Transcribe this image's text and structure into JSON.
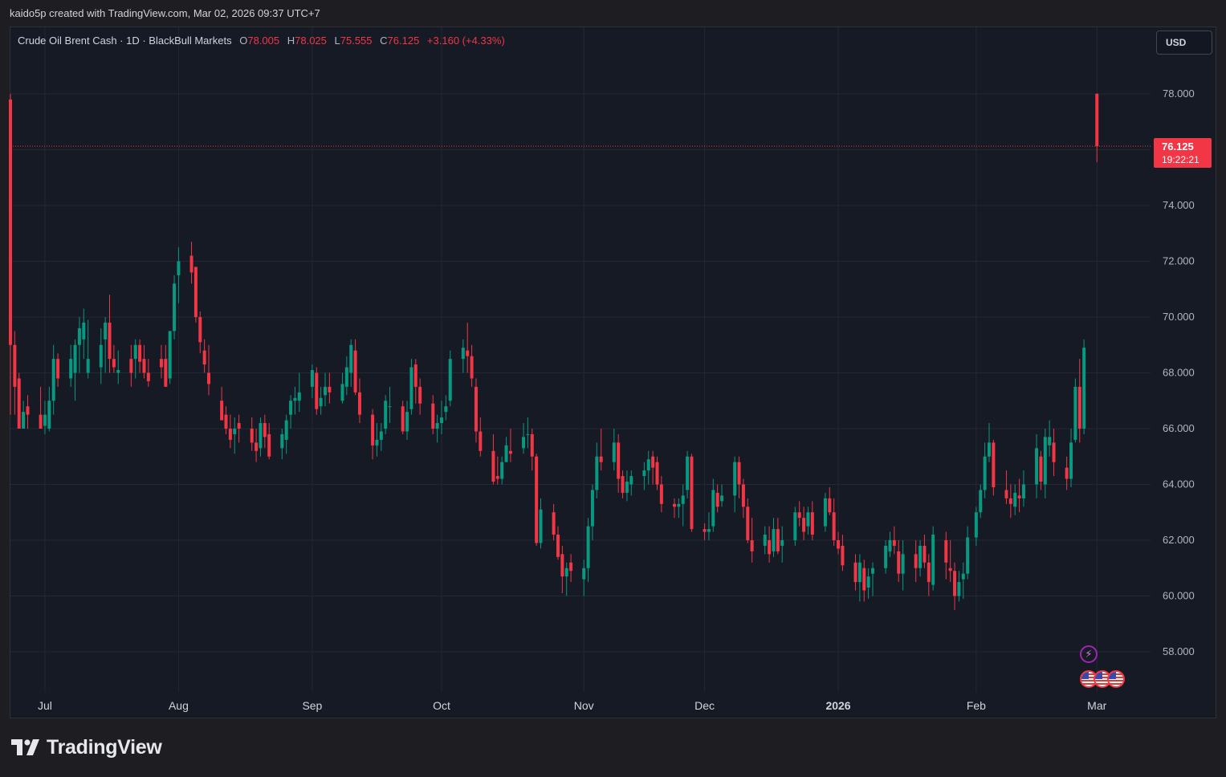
{
  "header": {
    "text": "kaido5p created with TradingView.com, Mar 02, 2026 09:37 UTC+7"
  },
  "legend": {
    "symbol": "Crude Oil Brent Cash · 1D · BlackBull Markets",
    "open_label": "O",
    "open": "78.005",
    "high_label": "H",
    "high": "78.025",
    "low_label": "L",
    "low": "75.555",
    "close_label": "C",
    "close": "76.125",
    "change": "+3.160 (+4.33%)"
  },
  "currency_button": "USD",
  "last_price": {
    "value": "76.125",
    "countdown": "19:22:21"
  },
  "footer": {
    "brand": "TradingView"
  },
  "icons": {
    "event": "lightning-icon",
    "flags": "us-flag-icon"
  },
  "colors": {
    "up": "#089981",
    "down": "#f23645",
    "background": "#161a25",
    "grid": "#242832"
  },
  "chart_data": {
    "type": "candlestick",
    "ylim": [
      57,
      80
    ],
    "y_ticks": [
      "78.000",
      "76.000",
      "74.000",
      "72.000",
      "70.000",
      "68.000",
      "66.000",
      "64.000",
      "62.000",
      "60.000",
      "58.000"
    ],
    "x_ticks": [
      "Jul",
      "Aug",
      "Sep",
      "Oct",
      "Nov",
      "Dec",
      "2026",
      "Feb",
      "Mar"
    ],
    "x_tick_dates": [
      "2025-07-01",
      "2025-08-01",
      "2025-09-01",
      "2025-10-01",
      "2025-11-03",
      "2025-12-01",
      "2026-01-01",
      "2026-02-02",
      "2026-03-02"
    ],
    "last_price": 76.125,
    "bars": [
      [
        "2025-06-23",
        77.8,
        78.0,
        66.5,
        69.0
      ],
      [
        "2025-06-24",
        69.0,
        69.5,
        66.5,
        67.5
      ],
      [
        "2025-06-25",
        67.8,
        68.0,
        66.2,
        66.0
      ],
      [
        "2025-06-26",
        66.0,
        67.0,
        66.0,
        66.6
      ],
      [
        "2025-06-27",
        66.8,
        67.2,
        66.0,
        66.5
      ],
      [
        "2025-06-30",
        66.5,
        67.5,
        66.2,
        66.0
      ],
      [
        "2025-07-01",
        66.1,
        67.0,
        65.8,
        66.5
      ],
      [
        "2025-07-02",
        66.0,
        67.5,
        65.9,
        67.0
      ],
      [
        "2025-07-03",
        67.0,
        69.0,
        66.5,
        68.5
      ],
      [
        "2025-07-04",
        68.5,
        68.7,
        67.5,
        67.8
      ],
      [
        "2025-07-07",
        67.8,
        69.0,
        67.5,
        68.5
      ],
      [
        "2025-07-08",
        68.0,
        69.2,
        67.0,
        69.0
      ],
      [
        "2025-07-09",
        69.0,
        70.0,
        68.0,
        69.6
      ],
      [
        "2025-07-10",
        69.2,
        70.3,
        68.5,
        69.8
      ],
      [
        "2025-07-11",
        68.0,
        69.9,
        67.8,
        68.5
      ],
      [
        "2025-07-14",
        68.2,
        69.6,
        67.6,
        69.0
      ],
      [
        "2025-07-15",
        69.2,
        70.0,
        68.0,
        69.8
      ],
      [
        "2025-07-16",
        69.8,
        70.8,
        68.0,
        68.5
      ],
      [
        "2025-07-17",
        68.5,
        69.0,
        68.0,
        68.2
      ],
      [
        "2025-07-18",
        68.0,
        68.8,
        67.6,
        68.1
      ],
      [
        "2025-07-21",
        68.5,
        69.0,
        67.5,
        68.0
      ],
      [
        "2025-07-22",
        68.5,
        69.2,
        67.8,
        69.0
      ],
      [
        "2025-07-23",
        69.0,
        69.2,
        68.0,
        68.4
      ],
      [
        "2025-07-24",
        68.5,
        69.0,
        67.8,
        68.0
      ],
      [
        "2025-07-25",
        68.0,
        68.5,
        67.5,
        67.7
      ],
      [
        "2025-07-28",
        68.5,
        69.0,
        67.8,
        68.2
      ],
      [
        "2025-07-29",
        68.5,
        69.0,
        67.5,
        67.5
      ],
      [
        "2025-07-30",
        67.8,
        69.5,
        67.6,
        69.5
      ],
      [
        "2025-07-31",
        69.5,
        71.5,
        69.2,
        71.2
      ],
      [
        "2025-08-01",
        71.5,
        72.5,
        70.5,
        72.0
      ],
      [
        "2025-08-04",
        72.2,
        72.7,
        71.2,
        71.6
      ],
      [
        "2025-08-05",
        71.8,
        71.8,
        69.8,
        70.0
      ],
      [
        "2025-08-06",
        70.0,
        70.2,
        68.7,
        69.1
      ],
      [
        "2025-08-07",
        68.8,
        69.2,
        68.0,
        68.3
      ],
      [
        "2025-08-08",
        68.0,
        69.0,
        67.2,
        67.6
      ],
      [
        "2025-08-11",
        67.0,
        67.5,
        66.5,
        66.3
      ],
      [
        "2025-08-12",
        66.5,
        66.8,
        65.8,
        66.0
      ],
      [
        "2025-08-13",
        66.0,
        66.5,
        65.3,
        65.6
      ],
      [
        "2025-08-14",
        65.8,
        66.4,
        65.1,
        66.0
      ],
      [
        "2025-08-15",
        66.2,
        66.5,
        65.5,
        66.0
      ],
      [
        "2025-08-18",
        66.0,
        66.4,
        65.2,
        65.5
      ],
      [
        "2025-08-19",
        65.5,
        66.0,
        64.8,
        65.2
      ],
      [
        "2025-08-20",
        65.3,
        66.4,
        65.0,
        66.2
      ],
      [
        "2025-08-21",
        66.2,
        66.5,
        65.3,
        65.7
      ],
      [
        "2025-08-22",
        65.8,
        66.2,
        64.9,
        65.0
      ],
      [
        "2025-08-25",
        65.3,
        66.0,
        64.9,
        65.8
      ],
      [
        "2025-08-26",
        65.6,
        66.5,
        65.1,
        66.3
      ],
      [
        "2025-08-27",
        66.5,
        67.2,
        66.0,
        67.0
      ],
      [
        "2025-08-28",
        67.0,
        67.5,
        66.5,
        67.1
      ],
      [
        "2025-08-29",
        67.0,
        68.0,
        66.6,
        67.3
      ],
      [
        "2025-09-01",
        67.5,
        68.3,
        67.1,
        68.1
      ],
      [
        "2025-09-02",
        68.0,
        68.2,
        66.5,
        66.7
      ],
      [
        "2025-09-03",
        66.8,
        67.5,
        66.5,
        67.1
      ],
      [
        "2025-09-04",
        67.2,
        68.0,
        66.8,
        67.5
      ],
      [
        "2025-09-05",
        67.5,
        68.0,
        66.9,
        67.3
      ],
      [
        "2025-09-08",
        67.0,
        68.0,
        66.9,
        67.6
      ],
      [
        "2025-09-09",
        67.5,
        68.6,
        67.2,
        68.2
      ],
      [
        "2025-09-10",
        68.0,
        69.2,
        67.5,
        69.0
      ],
      [
        "2025-09-11",
        68.8,
        69.2,
        67.2,
        67.3
      ],
      [
        "2025-09-12",
        67.3,
        67.8,
        66.2,
        66.5
      ],
      [
        "2025-09-15",
        66.5,
        66.7,
        64.9,
        65.4
      ],
      [
        "2025-09-16",
        65.4,
        66.2,
        65.0,
        65.6
      ],
      [
        "2025-09-17",
        65.6,
        66.2,
        65.2,
        65.9
      ],
      [
        "2025-09-18",
        66.0,
        67.2,
        65.8,
        67.0
      ],
      [
        "2025-09-19",
        66.8,
        67.5,
        66.2,
        66.8
      ],
      [
        "2025-09-22",
        66.8,
        67.0,
        65.8,
        65.9
      ],
      [
        "2025-09-23",
        65.9,
        67.0,
        65.6,
        66.6
      ],
      [
        "2025-09-24",
        66.7,
        68.5,
        66.5,
        68.2
      ],
      [
        "2025-09-25",
        68.3,
        68.5,
        66.9,
        67.5
      ],
      [
        "2025-09-26",
        67.5,
        67.8,
        66.5,
        66.9
      ],
      [
        "2025-09-29",
        66.9,
        67.2,
        65.8,
        66.0
      ],
      [
        "2025-09-30",
        66.0,
        66.5,
        65.5,
        66.2
      ],
      [
        "2025-10-01",
        66.2,
        67.0,
        65.8,
        66.4
      ],
      [
        "2025-10-02",
        66.6,
        67.2,
        66.3,
        66.8
      ],
      [
        "2025-10-03",
        67.0,
        68.8,
        66.8,
        68.5
      ],
      [
        "2025-10-06",
        68.5,
        69.2,
        68.0,
        68.9
      ],
      [
        "2025-10-07",
        68.8,
        69.8,
        68.0,
        68.6
      ],
      [
        "2025-10-08",
        68.6,
        69.0,
        67.5,
        67.8
      ],
      [
        "2025-10-09",
        67.5,
        67.8,
        65.5,
        65.9
      ],
      [
        "2025-10-10",
        65.9,
        66.4,
        65.0,
        65.2
      ],
      [
        "2025-10-13",
        65.2,
        65.8,
        64.0,
        64.1
      ],
      [
        "2025-10-14",
        64.3,
        65.0,
        64.0,
        64.2
      ],
      [
        "2025-10-15",
        64.2,
        65.0,
        64.0,
        64.8
      ],
      [
        "2025-10-16",
        64.8,
        65.7,
        64.8,
        65.4
      ],
      [
        "2025-10-17",
        65.2,
        66.0,
        64.8,
        65.1
      ],
      [
        "2025-10-20",
        65.3,
        66.2,
        65.1,
        65.7
      ],
      [
        "2025-10-21",
        65.8,
        66.4,
        65.3,
        65.8
      ],
      [
        "2025-10-22",
        65.8,
        66.0,
        64.5,
        65.0
      ],
      [
        "2025-10-23",
        65.0,
        65.1,
        61.8,
        61.9
      ],
      [
        "2025-10-24",
        61.9,
        63.5,
        61.7,
        63.1
      ],
      [
        "2025-10-27",
        63.0,
        63.3,
        62.0,
        62.2
      ],
      [
        "2025-10-28",
        62.2,
        62.5,
        61.3,
        61.4
      ],
      [
        "2025-10-29",
        61.5,
        61.8,
        60.1,
        60.7
      ],
      [
        "2025-10-30",
        60.7,
        61.2,
        60.0,
        61.0
      ],
      [
        "2025-10-31",
        61.2,
        61.5,
        60.5,
        60.9
      ],
      [
        "2025-11-03",
        60.6,
        61.3,
        60.0,
        61.0
      ],
      [
        "2025-11-04",
        61.0,
        62.8,
        60.5,
        62.5
      ],
      [
        "2025-11-05",
        62.5,
        64.0,
        62.0,
        63.8
      ],
      [
        "2025-11-06",
        63.8,
        65.5,
        63.5,
        65.0
      ],
      [
        "2025-11-07",
        65.0,
        66.0,
        64.5,
        64.8
      ],
      [
        "2025-11-10",
        64.8,
        66.0,
        64.5,
        65.5
      ],
      [
        "2025-11-11",
        65.5,
        65.8,
        63.7,
        64.2
      ],
      [
        "2025-11-12",
        64.3,
        64.5,
        63.5,
        63.7
      ],
      [
        "2025-11-13",
        63.7,
        64.5,
        63.4,
        64.1
      ],
      [
        "2025-11-14",
        64.0,
        64.5,
        63.6,
        64.3
      ],
      [
        "2025-11-17",
        64.3,
        64.8,
        63.8,
        64.5
      ],
      [
        "2025-11-18",
        64.5,
        65.2,
        64.0,
        64.9
      ],
      [
        "2025-11-19",
        65.0,
        65.2,
        64.0,
        64.6
      ],
      [
        "2025-11-20",
        64.8,
        65.0,
        63.8,
        64.0
      ],
      [
        "2025-11-21",
        64.0,
        64.3,
        63.0,
        63.3
      ],
      [
        "2025-11-24",
        63.3,
        63.5,
        62.8,
        63.2
      ],
      [
        "2025-11-25",
        63.2,
        63.5,
        62.8,
        63.3
      ],
      [
        "2025-11-26",
        63.3,
        64.0,
        62.5,
        63.6
      ],
      [
        "2025-11-27",
        63.8,
        65.2,
        63.5,
        65.0
      ],
      [
        "2025-11-28",
        65.0,
        65.1,
        62.3,
        62.4
      ],
      [
        "2025-12-01",
        62.4,
        62.6,
        62.0,
        62.3
      ],
      [
        "2025-12-02",
        62.3,
        63.0,
        62.0,
        62.4
      ],
      [
        "2025-12-03",
        62.5,
        64.2,
        62.3,
        63.8
      ],
      [
        "2025-12-04",
        63.7,
        64.0,
        63.0,
        63.2
      ],
      [
        "2025-12-05",
        63.4,
        64.0,
        63.2,
        63.6
      ],
      [
        "2025-12-08",
        63.6,
        65.0,
        63.0,
        64.8
      ],
      [
        "2025-12-09",
        64.8,
        65.0,
        63.5,
        64.0
      ],
      [
        "2025-12-10",
        64.0,
        64.2,
        62.8,
        63.2
      ],
      [
        "2025-12-11",
        63.2,
        63.5,
        61.9,
        62.0
      ],
      [
        "2025-12-12",
        62.0,
        62.8,
        61.2,
        61.6
      ],
      [
        "2025-12-15",
        61.8,
        62.5,
        61.5,
        62.2
      ],
      [
        "2025-12-16",
        62.0,
        62.5,
        61.2,
        61.5
      ],
      [
        "2025-12-17",
        61.6,
        62.8,
        61.4,
        62.4
      ],
      [
        "2025-12-18",
        62.4,
        62.8,
        61.5,
        61.6
      ],
      [
        "2025-12-19",
        61.8,
        62.5,
        61.2,
        62.0
      ],
      [
        "2025-12-22",
        62.0,
        63.2,
        61.8,
        63.0
      ],
      [
        "2025-12-23",
        63.0,
        63.4,
        62.5,
        62.8
      ],
      [
        "2025-12-24",
        62.8,
        63.2,
        62.0,
        62.3
      ],
      [
        "2025-12-25",
        62.5,
        63.2,
        62.2,
        63.0
      ],
      [
        "2025-12-26",
        63.0,
        63.4,
        62.0,
        62.2
      ],
      [
        "2025-12-29",
        62.5,
        63.7,
        62.3,
        63.5
      ],
      [
        "2025-12-30",
        63.5,
        63.9,
        62.9,
        63.0
      ],
      [
        "2025-12-31",
        63.0,
        63.5,
        61.8,
        62.0
      ],
      [
        "2026-01-01",
        62.0,
        62.3,
        61.5,
        61.7
      ],
      [
        "2026-01-02",
        61.8,
        62.2,
        60.9,
        61.1
      ],
      [
        "2026-01-05",
        61.2,
        61.5,
        60.2,
        60.5
      ],
      [
        "2026-01-06",
        60.5,
        61.5,
        59.8,
        61.2
      ],
      [
        "2026-01-07",
        61.0,
        61.3,
        59.8,
        60.2
      ],
      [
        "2026-01-08",
        60.3,
        61.0,
        59.9,
        60.7
      ],
      [
        "2026-01-09",
        60.8,
        61.2,
        60.0,
        61.0
      ],
      [
        "2026-01-12",
        61.0,
        62.0,
        60.8,
        61.8
      ],
      [
        "2026-01-13",
        61.6,
        62.3,
        61.4,
        62.0
      ],
      [
        "2026-01-14",
        62.0,
        62.5,
        61.5,
        61.8
      ],
      [
        "2026-01-15",
        61.6,
        62.0,
        60.5,
        60.8
      ],
      [
        "2026-01-16",
        60.8,
        62.0,
        60.2,
        61.5
      ],
      [
        "2026-01-19",
        61.5,
        62.0,
        60.5,
        61.0
      ],
      [
        "2026-01-20",
        61.0,
        62.0,
        60.7,
        61.8
      ],
      [
        "2026-01-21",
        61.8,
        62.2,
        61.0,
        61.2
      ],
      [
        "2026-01-22",
        61.2,
        61.5,
        60.0,
        60.5
      ],
      [
        "2026-01-23",
        60.4,
        62.5,
        60.2,
        62.2
      ],
      [
        "2026-01-26",
        62.0,
        62.3,
        60.6,
        61.2
      ],
      [
        "2026-01-27",
        61.0,
        62.0,
        60.5,
        60.9
      ],
      [
        "2026-01-28",
        60.9,
        61.2,
        59.5,
        60.0
      ],
      [
        "2026-01-29",
        60.0,
        60.9,
        59.8,
        60.5
      ],
      [
        "2026-01-30",
        60.6,
        61.2,
        59.9,
        60.8
      ],
      [
        "2026-01-31",
        60.8,
        62.5,
        60.6,
        62.1
      ]
    ],
    "bars_extra_note": "",
    "bars2": [
      [
        "2026-02-02",
        62.1,
        63.2,
        61.8,
        63.0
      ],
      [
        "2026-02-03",
        63.0,
        64.0,
        62.8,
        63.8
      ],
      [
        "2026-02-04",
        63.8,
        65.5,
        63.5,
        65.0
      ],
      [
        "2026-02-05",
        65.0,
        66.2,
        64.8,
        65.5
      ],
      [
        "2026-02-06",
        65.5,
        65.6,
        63.6,
        63.9
      ],
      [
        "2026-02-09",
        63.8,
        64.5,
        63.3,
        63.5
      ],
      [
        "2026-02-10",
        63.5,
        64.0,
        62.8,
        63.3
      ],
      [
        "2026-02-11",
        63.2,
        64.0,
        62.9,
        63.7
      ],
      [
        "2026-02-12",
        63.6,
        64.2,
        63.0,
        63.5
      ],
      [
        "2026-02-13",
        63.5,
        64.5,
        63.2,
        64.0
      ],
      [
        "2026-02-16",
        64.0,
        65.8,
        63.5,
        65.3
      ],
      [
        "2026-02-17",
        65.0,
        65.2,
        63.8,
        64.1
      ],
      [
        "2026-02-18",
        64.0,
        66.0,
        63.5,
        65.7
      ],
      [
        "2026-02-19",
        65.4,
        66.3,
        65.0,
        65.7
      ],
      [
        "2026-02-20",
        65.5,
        66.0,
        64.3,
        64.8
      ],
      [
        "2026-02-23",
        64.6,
        65.0,
        63.8,
        64.2
      ],
      [
        "2026-02-24",
        64.2,
        66.0,
        63.9,
        65.5
      ],
      [
        "2026-02-25",
        65.6,
        67.8,
        65.5,
        67.5
      ],
      [
        "2026-02-26",
        67.5,
        68.5,
        65.5,
        66.0
      ]
    ]
  }
}
